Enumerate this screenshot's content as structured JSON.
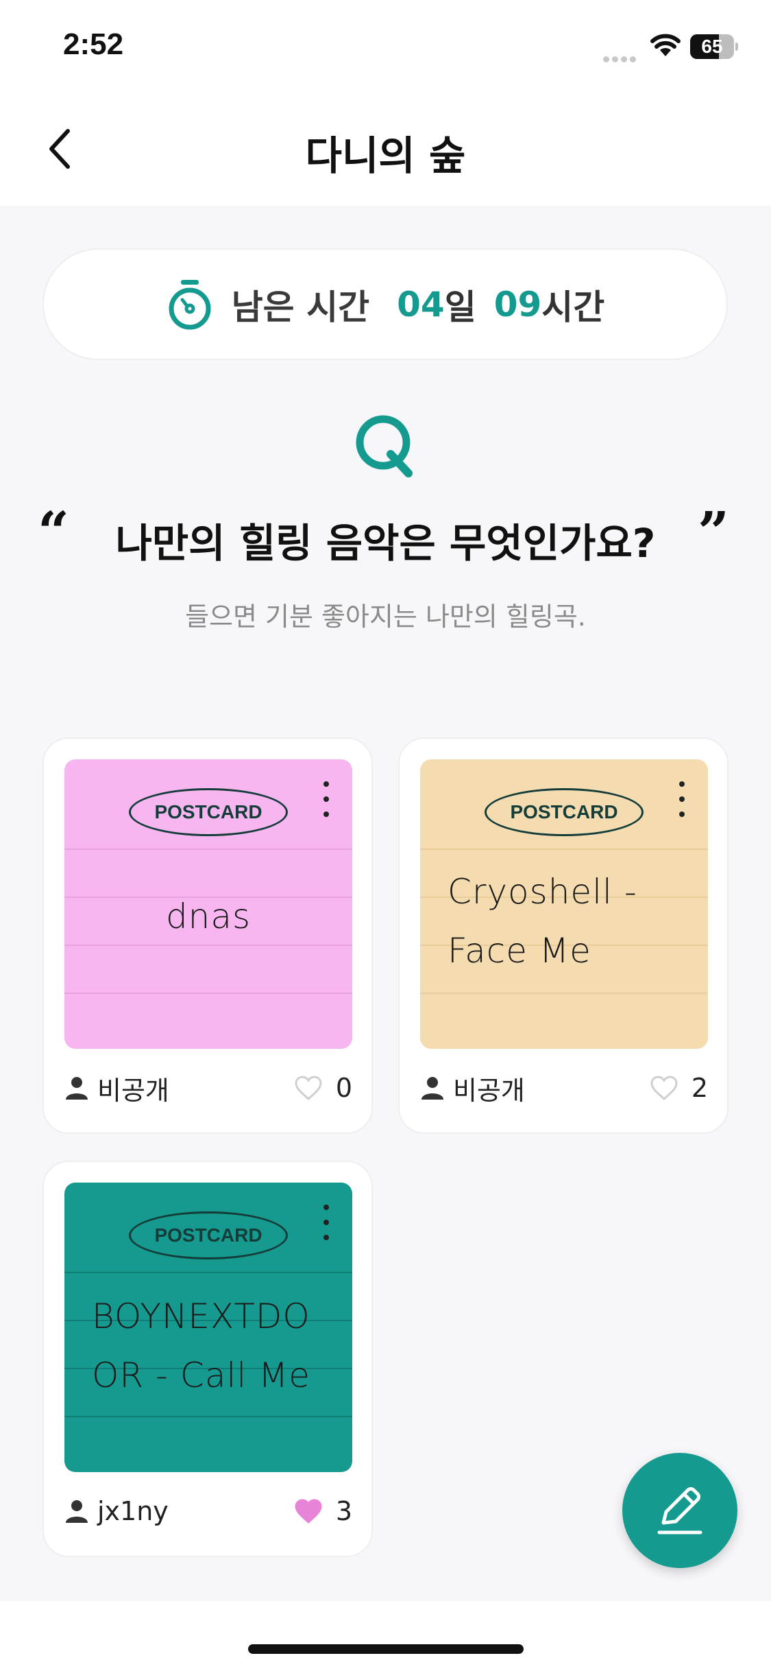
{
  "status_bar": {
    "time": "2:52",
    "battery_level": "65",
    "battery_fraction": 0.65,
    "signal_icon": "cellular-dots-icon",
    "wifi_icon": "wifi-icon"
  },
  "nav": {
    "back_icon": "chevron-left-icon",
    "title": "다니의 숲"
  },
  "timer": {
    "icon": "stopwatch-icon",
    "label": "남은 시간",
    "days_value": "04",
    "days_unit": "일",
    "hours_value": "09",
    "hours_unit": "시간"
  },
  "question": {
    "q_mark": "Q",
    "quote_open": "“",
    "quote_close": "”",
    "text": "나만의 힐링 음악은 무엇인가요?",
    "subtitle": "들으면 기분 좋아지는 나만의 힐링곡."
  },
  "cards": [
    {
      "badge": "POSTCARD",
      "content": "dnas",
      "author": "비공개",
      "likes": "0",
      "liked": false,
      "bg_color": "#f8b6f0",
      "line_color": "#e8a3df"
    },
    {
      "badge": "POSTCARD",
      "content": "Cryoshell -\nFace Me",
      "author": "비공개",
      "likes": "2",
      "liked": false,
      "bg_color": "#f5dcb0",
      "line_color": "#e8cc9a"
    },
    {
      "badge": "POSTCARD",
      "content": "BOYNEXTDO\nOR - Call Me",
      "author": "jx1ny",
      "likes": "3",
      "liked": true,
      "bg_color": "#169a8f",
      "line_color": "#0f7f75"
    }
  ],
  "colors": {
    "accent": "#159a8f",
    "heart_liked": "#e884d8",
    "heart_empty": "#cfcfcf"
  },
  "fab": {
    "icon": "pencil-icon"
  }
}
